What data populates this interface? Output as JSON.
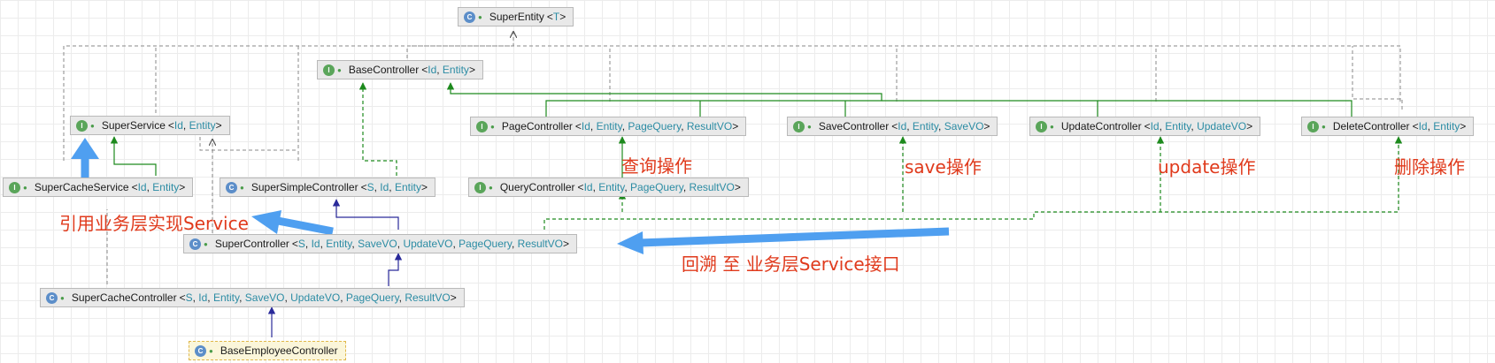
{
  "nodes": [
    {
      "id": "super-entity",
      "name": "SuperEntity",
      "kind": "C",
      "params": [
        "T"
      ]
    },
    {
      "id": "base-controller",
      "name": "BaseController",
      "kind": "I",
      "params": [
        "Id",
        "Entity"
      ]
    },
    {
      "id": "super-service",
      "name": "SuperService",
      "kind": "I",
      "params": [
        "Id",
        "Entity"
      ]
    },
    {
      "id": "page-controller",
      "name": "PageController",
      "kind": "I",
      "params": [
        "Id",
        "Entity",
        "PageQuery",
        "ResultVO"
      ]
    },
    {
      "id": "save-controller",
      "name": "SaveController",
      "kind": "I",
      "params": [
        "Id",
        "Entity",
        "SaveVO"
      ]
    },
    {
      "id": "update-controller",
      "name": "UpdateController",
      "kind": "I",
      "params": [
        "Id",
        "Entity",
        "UpdateVO"
      ]
    },
    {
      "id": "delete-controller",
      "name": "DeleteController",
      "kind": "I",
      "params": [
        "Id",
        "Entity"
      ]
    },
    {
      "id": "super-cache-service",
      "name": "SuperCacheService",
      "kind": "I",
      "params": [
        "Id",
        "Entity"
      ]
    },
    {
      "id": "super-simple-controller",
      "name": "SuperSimpleController",
      "kind": "C",
      "params": [
        "S",
        "Id",
        "Entity"
      ]
    },
    {
      "id": "query-controller",
      "name": "QueryController",
      "kind": "I",
      "params": [
        "Id",
        "Entity",
        "PageQuery",
        "ResultVO"
      ]
    },
    {
      "id": "super-controller",
      "name": "SuperController",
      "kind": "C",
      "params": [
        "S",
        "Id",
        "Entity",
        "SaveVO",
        "UpdateVO",
        "PageQuery",
        "ResultVO"
      ]
    },
    {
      "id": "super-cache-controller",
      "name": "SuperCacheController",
      "kind": "C",
      "params": [
        "S",
        "Id",
        "Entity",
        "SaveVO",
        "UpdateVO",
        "PageQuery",
        "ResultVO"
      ]
    },
    {
      "id": "base-employee-controller",
      "name": "BaseEmployeeController",
      "kind": "C",
      "params": []
    }
  ],
  "annotations": {
    "query": "查询操作",
    "save": "save操作",
    "update": "update操作",
    "delete": "删除操作",
    "use_service": "引用业务层实现Service",
    "trace_back": "回溯 至 业务层Service接口"
  },
  "colors": {
    "inherit": "#1d8a1d",
    "implement": "#2a2a9a",
    "dependency": "#8a8a8a",
    "annotation": "#e03a1c",
    "arrow": "#4f9ff0",
    "interface_badge": "#5aa55a",
    "class_badge": "#5c8ec9"
  }
}
